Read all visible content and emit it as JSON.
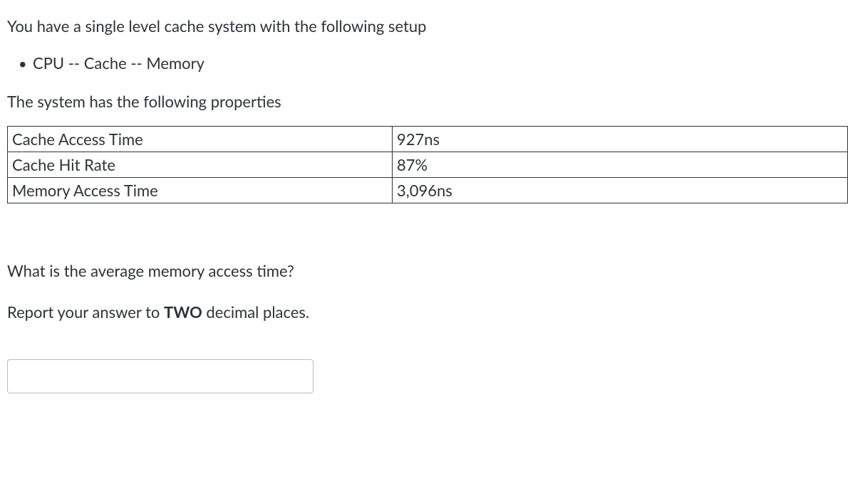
{
  "intro": "You have a single level cache system with the following setup",
  "setup_item": "CPU -- Cache -- Memory",
  "properties_intro": "The system has the following properties",
  "table": {
    "rows": [
      {
        "label": "Cache Access Time",
        "value": "927ns"
      },
      {
        "label": "Cache Hit Rate",
        "value": "87%"
      },
      {
        "label": "Memory Access Time",
        "value": "3,096ns"
      }
    ]
  },
  "question": "What is the average memory access time?",
  "instruction_prefix": "Report your answer to ",
  "instruction_bold": "TWO",
  "instruction_suffix": " decimal places.",
  "answer_value": ""
}
